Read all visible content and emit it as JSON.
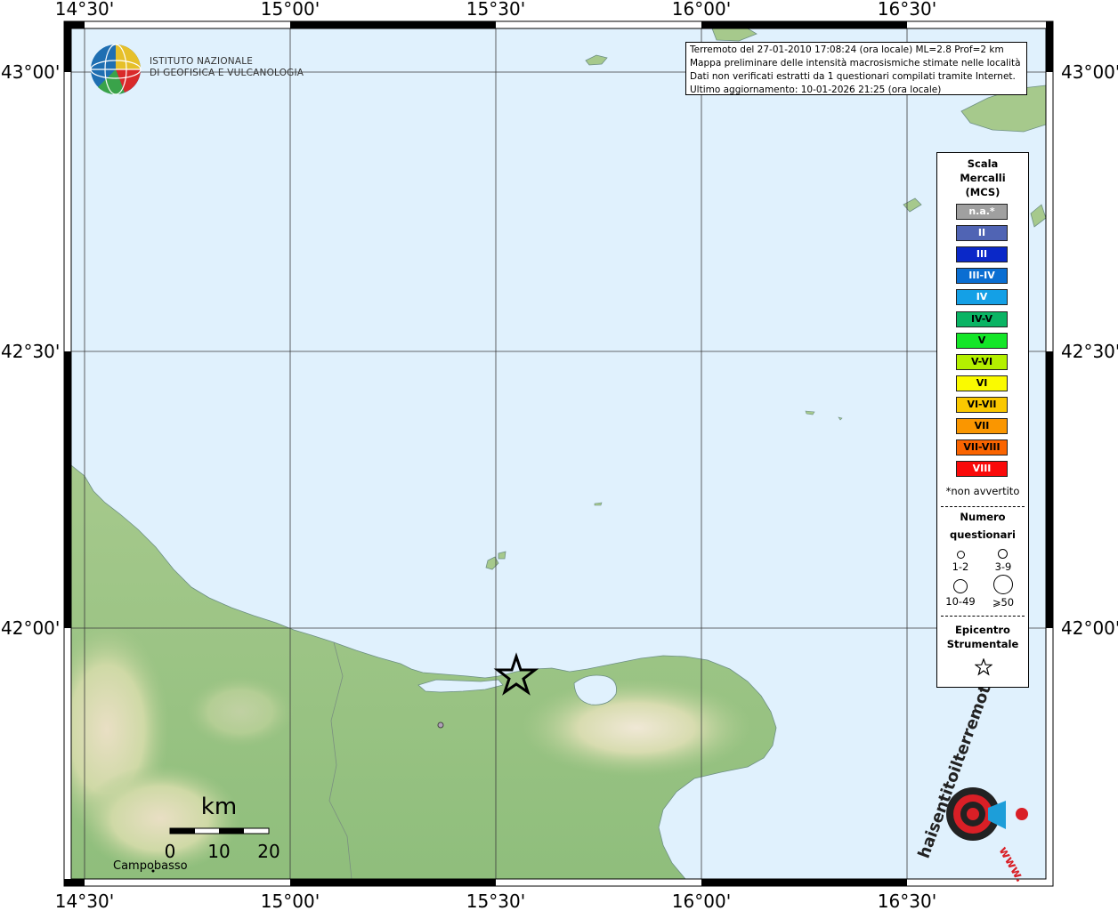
{
  "map": {
    "lon_labels": [
      "14°30'",
      "15°00'",
      "15°30'",
      "16°00'",
      "16°30'"
    ],
    "lat_labels": [
      "43°00'",
      "42°30'",
      "42°00'"
    ],
    "colors": {
      "sea": "#e0f1fd",
      "land_low": "#9fc488",
      "land_high": "#eae0c8",
      "frame": "#000000",
      "grid": "#3a3a3a"
    },
    "city_label": "Campobasso"
  },
  "logo": {
    "line1": "ISTITUTO NAZIONALE",
    "line2": "DI GEOFISICA E VULCANOLOGIA",
    "icon": "ingv-globe-icon"
  },
  "info": {
    "line1": "Terremoto del 27-01-2010 17:08:24 (ora locale) ML=2.8 Prof=2 km",
    "line2": "Mappa preliminare delle intensità macrosismiche stimate nelle località",
    "line3": "Dati non verificati estratti da 1 questionari compilati tramite Internet.",
    "line4": "Ultimo aggiornamento: 10-01-2026 21:25 (ora locale)"
  },
  "legend": {
    "title1": "Scala",
    "title2": "Mercalli",
    "title3": "(MCS)",
    "items": [
      {
        "label": "n.a.*",
        "color": "#a0a0a0"
      },
      {
        "label": "II",
        "color": "#5064b4"
      },
      {
        "label": "III",
        "color": "#0a28c8"
      },
      {
        "label": "III-IV",
        "color": "#0a6ed2"
      },
      {
        "label": "IV",
        "color": "#14a0e6"
      },
      {
        "label": "IV-V",
        "color": "#0ab464"
      },
      {
        "label": "V",
        "color": "#14e628"
      },
      {
        "label": "V-VI",
        "color": "#b4f000"
      },
      {
        "label": "VI",
        "color": "#fafa00"
      },
      {
        "label": "VI-VII",
        "color": "#fac800"
      },
      {
        "label": "VII",
        "color": "#fa9600"
      },
      {
        "label": "VII-VIII",
        "color": "#fa6400"
      },
      {
        "label": "VIII",
        "color": "#fa0a0a"
      }
    ],
    "note": "*non avvertito",
    "count_title1": "Numero",
    "count_title2": "questionari",
    "counts": [
      "1-2",
      "3-9",
      "10-49",
      "⩾50"
    ],
    "epicenter_title1": "Epicentro",
    "epicenter_title2": "Strumentale"
  },
  "scalebar": {
    "unit": "km",
    "ticks": [
      "0",
      "10",
      "20"
    ]
  },
  "brand": {
    "text": "haisentitoilterremoto.it",
    "url_text": "www.",
    "icon": "target-megaphone-icon"
  }
}
